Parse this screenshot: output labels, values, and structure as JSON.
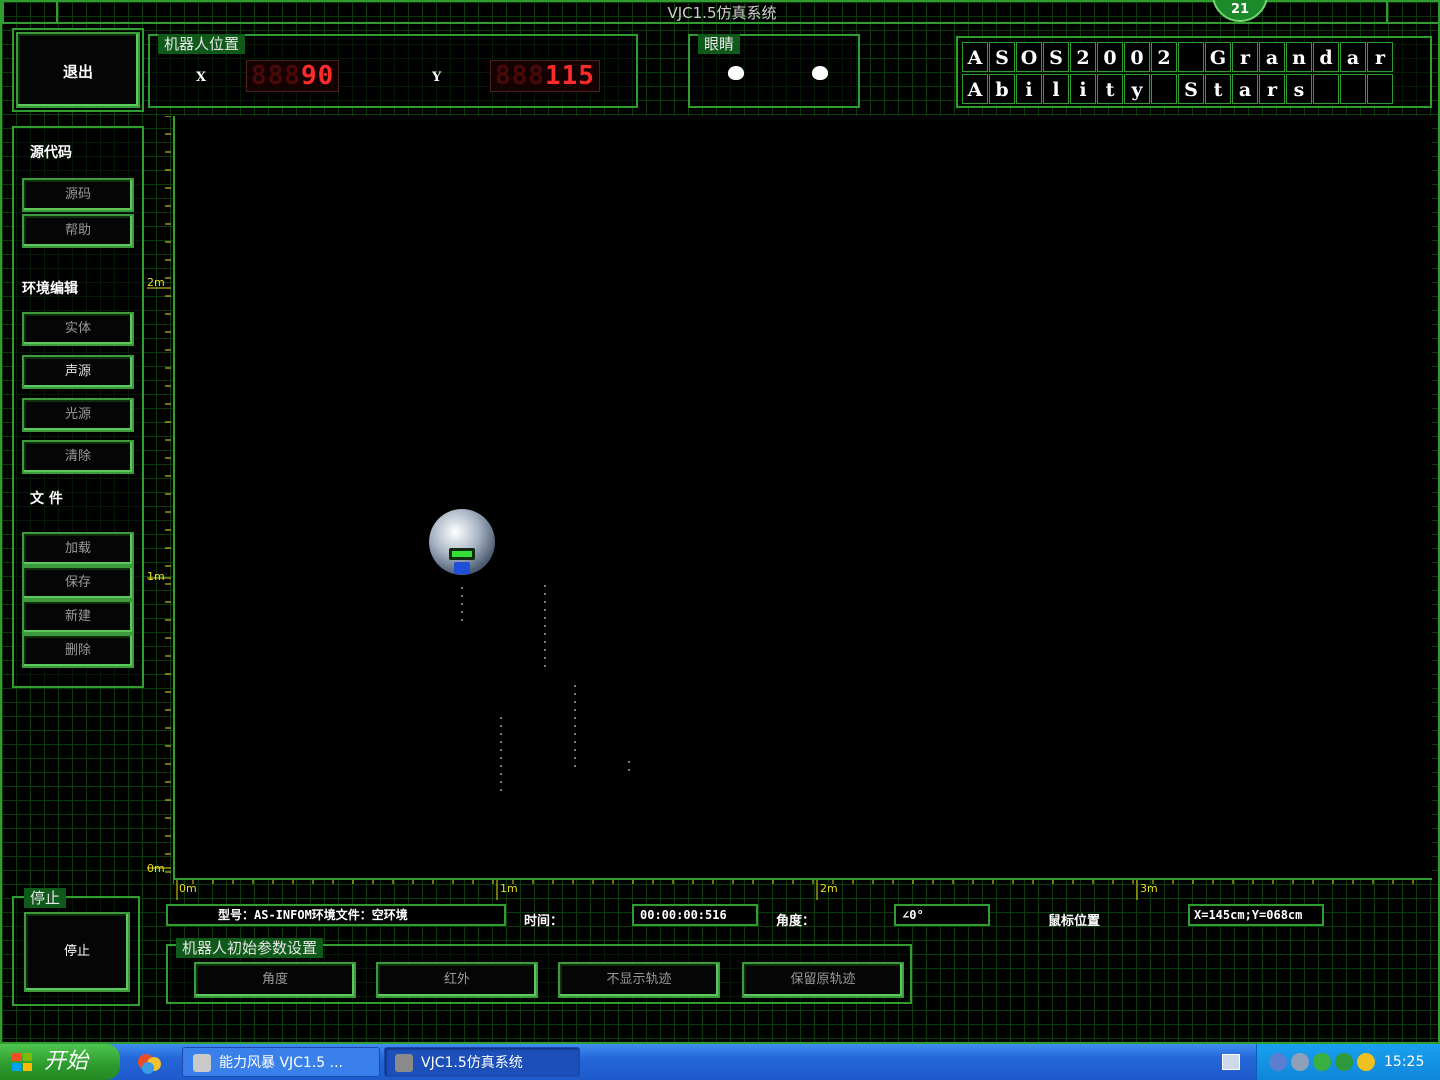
{
  "window": {
    "title": "VJC1.5仿真系统",
    "badge": "21"
  },
  "exit_label": "退出",
  "position_panel": {
    "title": "机器人位置",
    "x_label": "X",
    "x_ghost": "888",
    "x_value": "90",
    "y_label": "Y",
    "y_ghost": "888",
    "y_value": "115"
  },
  "eyes_panel": {
    "title": "眼睛"
  },
  "aso_board": {
    "row1": [
      "A",
      "S",
      "O",
      "S",
      "2",
      "0",
      "0",
      "2",
      "",
      "G",
      "r",
      "a",
      "n",
      "d",
      "a",
      "r"
    ],
    "row2": [
      "A",
      "b",
      "i",
      "l",
      "i",
      "t",
      "y",
      "",
      "S",
      "t",
      "a",
      "r",
      "s",
      "",
      "",
      ""
    ]
  },
  "sidebar": {
    "source_label": "源代码",
    "source_buttons": [
      "源码",
      "帮助"
    ],
    "env_label": "环境编辑",
    "env_buttons": [
      "实体",
      "声源",
      "光源",
      "清除"
    ],
    "file_label": "文 件",
    "file_buttons": [
      "加载",
      "保存",
      "新建",
      "删除"
    ]
  },
  "stop_panel": {
    "title": "停止",
    "button": "停止"
  },
  "rulers": {
    "vertical": [
      "2m",
      "1m",
      "0m"
    ],
    "horizontal": [
      "0m",
      "1m",
      "2m",
      "3m"
    ]
  },
  "status": {
    "model_text": "型号：AS-INFOM环境文件：空环境",
    "time_label": "时间：",
    "time_value": "00:00:00:516",
    "angle_label": "角度：",
    "angle_value": "∠0°",
    "mouse_label": "鼠标位置",
    "mouse_value": "X=145cm;Y=068cm"
  },
  "init_panel": {
    "title": "机器人初始参数设置",
    "buttons": [
      "角度",
      "红外",
      "不显示轨迹",
      "保留原轨迹"
    ]
  },
  "taskbar": {
    "start": "开始",
    "tasks": [
      "能力风暴 VJC1.5 ...",
      "VJC1.5仿真系统"
    ],
    "clock": "15:25"
  }
}
